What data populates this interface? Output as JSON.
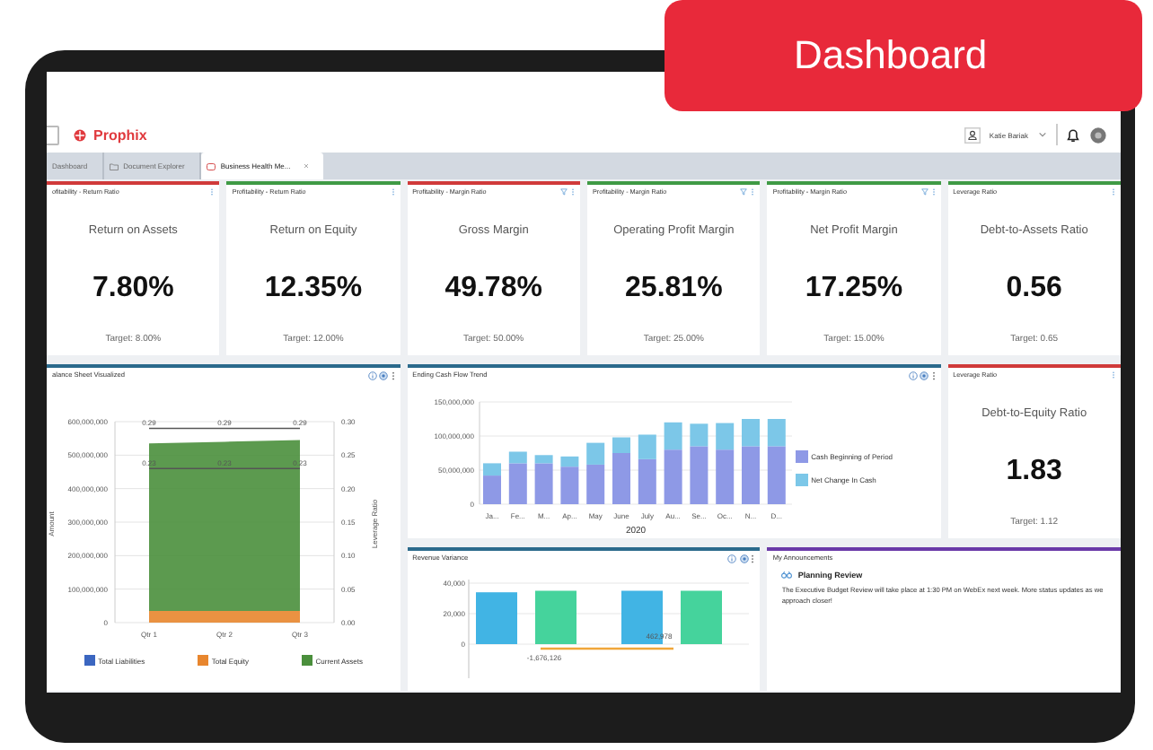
{
  "badge": {
    "label": "Dashboard"
  },
  "header": {
    "logo": "Prophix",
    "user": "Katie Bariak"
  },
  "tabs": [
    {
      "label": "Dashboard",
      "kind": "plain",
      "selected": false,
      "closable": false
    },
    {
      "label": "Document Explorer",
      "kind": "folder",
      "selected": false,
      "closable": false
    },
    {
      "label": "Business Health Me...",
      "kind": "dashboard",
      "selected": true,
      "closable": true
    }
  ],
  "kpi_cards": [
    {
      "category": "ofitability - Return Ratio",
      "name": "Return on Assets",
      "value": "7.80%",
      "target": "Target: 8.00%",
      "color": "#d03a3a",
      "filter": false
    },
    {
      "category": "Profitability - Return Ratio",
      "name": "Return on Equity",
      "value": "12.35%",
      "target": "Target: 12.00%",
      "color": "#3f9a45",
      "filter": false
    },
    {
      "category": "Profitability - Margin Ratio",
      "name": "Gross Margin",
      "value": "49.78%",
      "target": "Target: 50.00%",
      "color": "#d03a3a",
      "filter": true
    },
    {
      "category": "Profitability - Margin Ratio",
      "name": "Operating Profit Margin",
      "value": "25.81%",
      "target": "Target: 25.00%",
      "color": "#3f9a45",
      "filter": true
    },
    {
      "category": "Profitability - Margin Ratio",
      "name": "Net Profit Margin",
      "value": "17.25%",
      "target": "Target: 15.00%",
      "color": "#3f9a45",
      "filter": true
    },
    {
      "category": "Leverage Ratio",
      "name": "Debt-to-Assets Ratio",
      "value": "0.56",
      "target": "Target: 0.65",
      "color": "#3f9a45",
      "filter": false
    },
    {
      "category": "Leverage Ratio",
      "name": "Debt-to-Equity Ratio",
      "value": "1.83",
      "target": "Target: 1.12",
      "color": "#d03a3a",
      "filter": false
    }
  ],
  "balance_panel": {
    "title": "alance Sheet Visualized",
    "color": "#2b6a8c",
    "tools": true,
    "chart_data": {
      "type": "area",
      "stacked": true,
      "grid": true,
      "ylabel": "Amount",
      "y2label": "Leverage Ratio",
      "categories": [
        "Qtr 1",
        "Qtr 2",
        "Qtr 3"
      ],
      "series": [
        {
          "name": "Total Liabilities",
          "color": "#3b66c0",
          "values": [
            null,
            null,
            null
          ]
        },
        {
          "name": "Total Equity",
          "color": "#e8862e",
          "values": [
            35000000,
            35000000,
            35000000
          ]
        },
        {
          "name": "Current Assets",
          "color": "#4a8f3c",
          "values": [
            500000000,
            505000000,
            510000000
          ]
        },
        {
          "type": "line",
          "axis": "y2",
          "color": "#555555",
          "values": [
            0.29,
            0.29,
            0.29
          ]
        },
        {
          "type": "line",
          "axis": "y2",
          "color": "#555555",
          "values": [
            0.23,
            0.23,
            0.23
          ]
        }
      ],
      "ylim": [
        0,
        600000000
      ],
      "yticks": [
        {
          "value": 0,
          "label": "0"
        },
        {
          "value": 100000000,
          "label": "100,000,000"
        },
        {
          "value": 200000000,
          "label": "200,000,000"
        },
        {
          "value": 300000000,
          "label": "300,000,000"
        },
        {
          "value": 400000000,
          "label": "400,000,000"
        },
        {
          "value": 500000000,
          "label": "500,000,000"
        },
        {
          "value": 600000000,
          "label": "600,000,000"
        }
      ],
      "y2lim": [
        0,
        0.3
      ],
      "y2ticks": [
        {
          "value": 0,
          "label": "0.00"
        },
        {
          "value": 0.05,
          "label": "0.05"
        },
        {
          "value": 0.1,
          "label": "0.10"
        },
        {
          "value": 0.15,
          "label": "0.15"
        },
        {
          "value": 0.2,
          "label": "0.20"
        },
        {
          "value": 0.25,
          "label": "0.25"
        },
        {
          "value": 0.3,
          "label": "0.30"
        }
      ],
      "annotations": [
        "0.29",
        "0.29",
        "0.29",
        "0.23",
        "0.23",
        "0.23"
      ]
    }
  },
  "cash_panel": {
    "title": "Ending Cash Flow Trend",
    "color": "#2b6a8c",
    "tools": true,
    "chart_data": {
      "type": "bar",
      "stacked": true,
      "grid": true,
      "xlabel": "2020",
      "categories": [
        "Ja...",
        "Fe...",
        "M...",
        "Ap...",
        "May",
        "June",
        "July",
        "Au...",
        "Se...",
        "Oc...",
        "N...",
        "D..."
      ],
      "series": [
        {
          "name": "Cash Beginning of Period",
          "color": "#8e99e6",
          "values": [
            42000000,
            60000000,
            60000000,
            55000000,
            58000000,
            75000000,
            66000000,
            80000000,
            85000000,
            80000000,
            85000000,
            85000000
          ]
        },
        {
          "name": "Net Change In Cash",
          "color": "#7cc7e8",
          "values": [
            18000000,
            17000000,
            12000000,
            15000000,
            32000000,
            23000000,
            36000000,
            40000000,
            33000000,
            39000000,
            40000000,
            40000000
          ]
        }
      ],
      "ylim": [
        0,
        150000000
      ],
      "yticks": [
        {
          "value": 0,
          "label": "0"
        },
        {
          "value": 50000000,
          "label": "50,000,000"
        },
        {
          "value": 100000000,
          "label": "100,000,000"
        },
        {
          "value": 150000000,
          "label": "150,000,000"
        }
      ]
    }
  },
  "revenue_panel": {
    "title": "Revenue Variance",
    "color": "#2b6a8c",
    "tools": true,
    "chart_data": {
      "type": "bar",
      "grid": true,
      "series": [
        {
          "color": "#41b4e4",
          "values": [
            34000,
            35000
          ]
        },
        {
          "color": "#45d39c",
          "values": [
            35000,
            35000
          ]
        }
      ],
      "ylim": [
        0,
        40000
      ],
      "yticks": [
        {
          "value": 0,
          "label": "0"
        },
        {
          "value": 20000,
          "label": "20,000"
        },
        {
          "value": 40000,
          "label": "40,000"
        }
      ],
      "annotations": [
        {
          "text": "-1,676,126"
        },
        {
          "text": "462,978"
        }
      ]
    }
  },
  "announcements": {
    "title": "My Announcements",
    "color": "#6a3aa8",
    "items": [
      {
        "title": "Planning Review",
        "body": "The Executive Budget Review will take place at 1:30 PM on WebEx next week. More status updates as we approach closer!"
      }
    ]
  }
}
